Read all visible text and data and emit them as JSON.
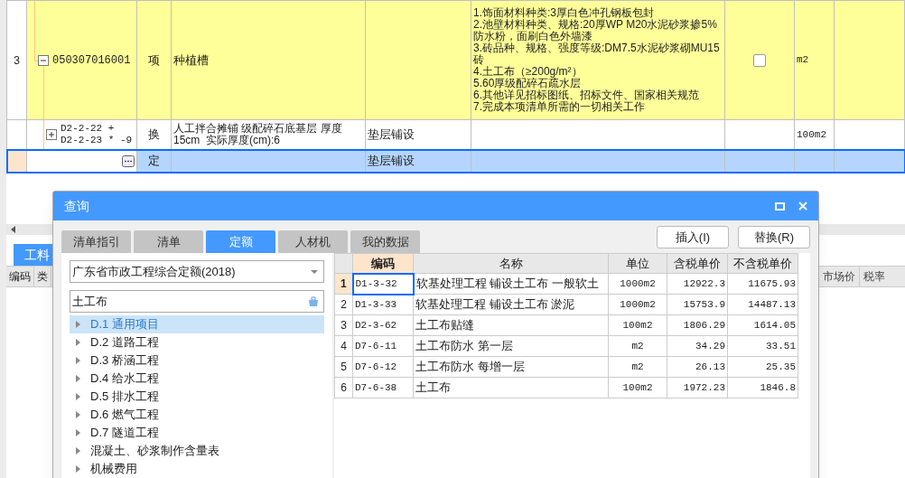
{
  "sheet": {
    "rows": [
      {
        "kind": "item",
        "number": "3",
        "expanded": true,
        "code": "050307016001",
        "type": "项",
        "name": "种植槽",
        "features": [
          "1.饰面材料种类:3厚白色冲孔钢板包封",
          "2.池壁材料种类、规格:20厚WP M20水泥砂浆掺5%防水粉，面刷白色外墙漆",
          "3.砖品种、规格、强度等级:DM7.5水泥砂浆砌MU15砖",
          "4.土工布（≥200g/m²）",
          "5.60厚级配碎石疏水层",
          "6.其他详见招标图纸、招标文件、国家相关规范",
          "7.完成本项清单所需的一切相关工作"
        ],
        "checked": false,
        "unit": "m2"
      },
      {
        "kind": "norm",
        "expanded": false,
        "code_lines": [
          "D2-2-22 +",
          "D2-2-23 * -9"
        ],
        "type": "换",
        "name_lines": [
          "人工拌合摊铺 级配碎石底基层 厚度",
          "15cm  实际厚度(cm):6"
        ],
        "work": "垫层铺设",
        "unit": "100m2"
      },
      {
        "kind": "edit",
        "type": "定",
        "work": "垫层铺设",
        "selected": true
      }
    ]
  },
  "bottom_panel": {
    "tab": "工料",
    "columns": [
      "编码",
      "类"
    ],
    "right_columns": [
      "市场价",
      "税率"
    ]
  },
  "dialog": {
    "title": "查询",
    "tabs": [
      {
        "label": "清单指引",
        "selected": false
      },
      {
        "label": "清单",
        "selected": false
      },
      {
        "label": "定额",
        "selected": true
      },
      {
        "label": "人材机",
        "selected": false
      },
      {
        "label": "我的数据",
        "selected": false
      }
    ],
    "buttons": [
      "插入(I)",
      "替换(R)"
    ],
    "library": "广东省市政工程综合定额(2018)",
    "search": "土工布",
    "tree": [
      {
        "label": "D.1 通用项目",
        "selected": true
      },
      {
        "label": "D.2 道路工程",
        "selected": false
      },
      {
        "label": "D.3 桥涵工程",
        "selected": false
      },
      {
        "label": "D.4 给水工程",
        "selected": false
      },
      {
        "label": "D.5 排水工程",
        "selected": false
      },
      {
        "label": "D.6 燃气工程",
        "selected": false
      },
      {
        "label": "D.7 隧道工程",
        "selected": false
      },
      {
        "label": "混凝土、砂浆制作含量表",
        "selected": false
      },
      {
        "label": "机械费用",
        "selected": false
      }
    ],
    "columns": [
      {
        "label": "编码",
        "selected": true
      },
      {
        "label": "名称",
        "selected": false
      },
      {
        "label": "单位",
        "selected": false
      },
      {
        "label": "含税单价",
        "selected": false
      },
      {
        "label": "不含税单价",
        "selected": false
      }
    ],
    "rows": [
      {
        "number": "1",
        "code": "D1-3-32",
        "name": "软基处理工程 铺设土工布 一般软土",
        "unit": "1000m2",
        "price_tax": "12922.3",
        "price_notax": "11675.93",
        "selected": true
      },
      {
        "number": "2",
        "code": "D1-3-33",
        "name": "软基处理工程 铺设土工布 淤泥",
        "unit": "1000m2",
        "price_tax": "15753.9",
        "price_notax": "14487.13",
        "selected": false
      },
      {
        "number": "3",
        "code": "D2-3-62",
        "name": "土工布贴缝",
        "unit": "100m2",
        "price_tax": "1806.29",
        "price_notax": "1614.05",
        "selected": false
      },
      {
        "number": "4",
        "code": "D7-6-11",
        "name": "土工布防水 第一层",
        "unit": "m2",
        "price_tax": "34.29",
        "price_notax": "33.51",
        "selected": false
      },
      {
        "number": "5",
        "code": "D7-6-12",
        "name": "土工布防水 每增一层",
        "unit": "m2",
        "price_tax": "26.13",
        "price_notax": "25.35",
        "selected": false
      },
      {
        "number": "6",
        "code": "D7-6-38",
        "name": "土工布",
        "unit": "100m2",
        "price_tax": "1972.23",
        "price_notax": "1846.8",
        "selected": false
      }
    ]
  }
}
